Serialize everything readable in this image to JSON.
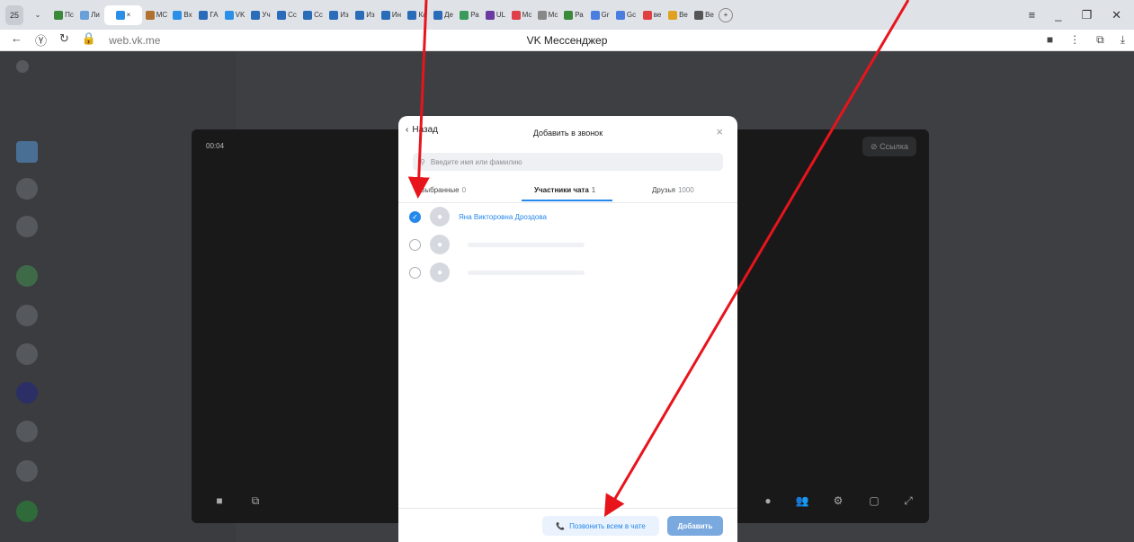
{
  "browser": {
    "tab_count": "25",
    "tabs": [
      {
        "label": "Пс",
        "color": "#3a8a3a"
      },
      {
        "label": "Ли",
        "color": "#6aa0d8"
      },
      {
        "label": "×",
        "color": "#2b8fe8",
        "active": true
      },
      {
        "label": "МС",
        "color": "#b07030"
      },
      {
        "label": "Вх",
        "color": "#2b8fe8"
      },
      {
        "label": "ГА",
        "color": "#2b6cb8"
      },
      {
        "label": "VK",
        "color": "#2b8fe8"
      },
      {
        "label": "Уч",
        "color": "#2b6cb8"
      },
      {
        "label": "Сс",
        "color": "#2b6cb8"
      },
      {
        "label": "Сс",
        "color": "#2b6cb8"
      },
      {
        "label": "Из",
        "color": "#2b6cb8"
      },
      {
        "label": "Из",
        "color": "#2b6cb8"
      },
      {
        "label": "Ин",
        "color": "#2b6cb8"
      },
      {
        "label": "Ка",
        "color": "#2b6cb8"
      },
      {
        "label": "Де",
        "color": "#2b6cb8"
      },
      {
        "label": "Ра",
        "color": "#3a9a5a"
      },
      {
        "label": "UL",
        "color": "#6a3aa0"
      },
      {
        "label": "Мс",
        "color": "#e0404a"
      },
      {
        "label": "Мс",
        "color": "#888888"
      },
      {
        "label": "Ра",
        "color": "#3a8a3a"
      },
      {
        "label": "Gr",
        "color": "#4a7de0"
      },
      {
        "label": "Gc",
        "color": "#4a7de0"
      },
      {
        "label": "ве",
        "color": "#e04040"
      },
      {
        "label": "Ве",
        "color": "#e0a020"
      },
      {
        "label": "Ве",
        "color": "#555555"
      }
    ],
    "add_tab": "+",
    "url": "web.vk.me",
    "page_title": "VK Мессенджер"
  },
  "call": {
    "timer": "00:04",
    "link_label": "Ссылка"
  },
  "modal": {
    "back_label": "Назад",
    "title": "Добавить в звонок",
    "close": "×",
    "search_placeholder": "Введите имя или фамилию",
    "tabs": [
      {
        "label": "Выбранные",
        "count": "0"
      },
      {
        "label": "Участники чата",
        "count": "1",
        "selected": true
      },
      {
        "label": "Друзья",
        "count": "1000"
      }
    ],
    "members": [
      {
        "name": "Яна Викторовна Дроздова",
        "checked": true
      },
      {
        "name": "",
        "checked": false
      },
      {
        "name": "",
        "checked": false
      }
    ],
    "call_all_label": "Позвонить всем в чате",
    "add_label": "Добавить"
  },
  "colors": {
    "accent": "#2688eb",
    "annotation_arrow": "#e8141c",
    "overlay": "#3d3f42"
  }
}
